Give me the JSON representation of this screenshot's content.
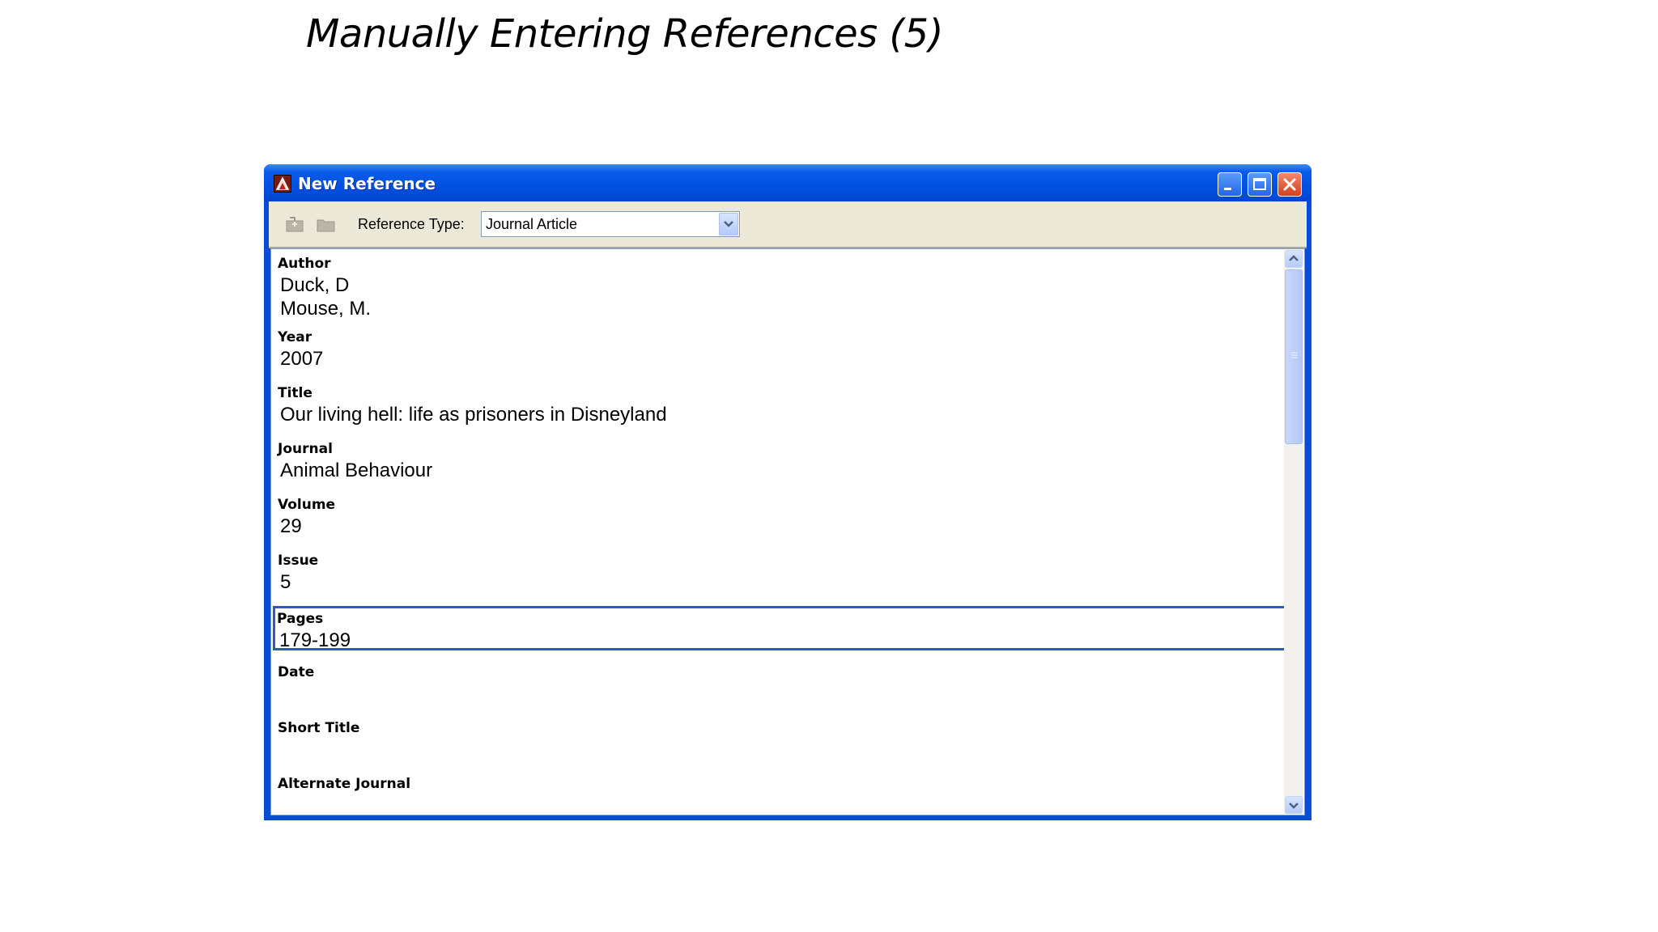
{
  "slide": {
    "title": "Manually Entering References (5)"
  },
  "window": {
    "title": "New Reference",
    "controls": [
      "minimize-icon",
      "maximize-icon",
      "close-icon"
    ]
  },
  "toolbar": {
    "icons": [
      "insert-reference-icon",
      "folder-icon"
    ],
    "reference_type_label": "Reference Type:",
    "reference_type_value": "Journal Article"
  },
  "colors": {
    "titlebar": "#0a5ce9",
    "active_field_border": "#2e5bb8",
    "toolbar_bg": "#ece9d8"
  },
  "fields": [
    {
      "label": "Author",
      "lines": [
        "Duck, D",
        "Mouse, M."
      ]
    },
    {
      "label": "Year",
      "lines": [
        "2007"
      ]
    },
    {
      "label": "Title",
      "lines": [
        "Our living hell: life as prisoners in Disneyland"
      ]
    },
    {
      "label": "Journal",
      "lines": [
        "Animal Behaviour"
      ]
    },
    {
      "label": "Volume",
      "lines": [
        "29"
      ]
    },
    {
      "label": "Issue",
      "lines": [
        "5"
      ]
    },
    {
      "label": "Pages",
      "lines": [
        "179-199"
      ],
      "active": true
    },
    {
      "label": "Date",
      "lines": []
    },
    {
      "label": "Short Title",
      "lines": []
    },
    {
      "label": "Alternate Journal",
      "lines": []
    }
  ]
}
